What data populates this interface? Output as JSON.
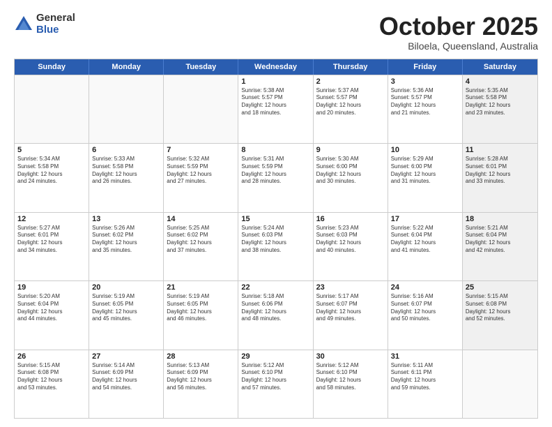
{
  "logo": {
    "general": "General",
    "blue": "Blue"
  },
  "title": "October 2025",
  "location": "Biloela, Queensland, Australia",
  "weekdays": [
    "Sunday",
    "Monday",
    "Tuesday",
    "Wednesday",
    "Thursday",
    "Friday",
    "Saturday"
  ],
  "rows": [
    [
      {
        "day": "",
        "text": ""
      },
      {
        "day": "",
        "text": ""
      },
      {
        "day": "",
        "text": ""
      },
      {
        "day": "1",
        "text": "Sunrise: 5:38 AM\nSunset: 5:57 PM\nDaylight: 12 hours\nand 18 minutes."
      },
      {
        "day": "2",
        "text": "Sunrise: 5:37 AM\nSunset: 5:57 PM\nDaylight: 12 hours\nand 20 minutes."
      },
      {
        "day": "3",
        "text": "Sunrise: 5:36 AM\nSunset: 5:57 PM\nDaylight: 12 hours\nand 21 minutes."
      },
      {
        "day": "4",
        "text": "Sunrise: 5:35 AM\nSunset: 5:58 PM\nDaylight: 12 hours\nand 23 minutes."
      }
    ],
    [
      {
        "day": "5",
        "text": "Sunrise: 5:34 AM\nSunset: 5:58 PM\nDaylight: 12 hours\nand 24 minutes."
      },
      {
        "day": "6",
        "text": "Sunrise: 5:33 AM\nSunset: 5:58 PM\nDaylight: 12 hours\nand 26 minutes."
      },
      {
        "day": "7",
        "text": "Sunrise: 5:32 AM\nSunset: 5:59 PM\nDaylight: 12 hours\nand 27 minutes."
      },
      {
        "day": "8",
        "text": "Sunrise: 5:31 AM\nSunset: 5:59 PM\nDaylight: 12 hours\nand 28 minutes."
      },
      {
        "day": "9",
        "text": "Sunrise: 5:30 AM\nSunset: 6:00 PM\nDaylight: 12 hours\nand 30 minutes."
      },
      {
        "day": "10",
        "text": "Sunrise: 5:29 AM\nSunset: 6:00 PM\nDaylight: 12 hours\nand 31 minutes."
      },
      {
        "day": "11",
        "text": "Sunrise: 5:28 AM\nSunset: 6:01 PM\nDaylight: 12 hours\nand 33 minutes."
      }
    ],
    [
      {
        "day": "12",
        "text": "Sunrise: 5:27 AM\nSunset: 6:01 PM\nDaylight: 12 hours\nand 34 minutes."
      },
      {
        "day": "13",
        "text": "Sunrise: 5:26 AM\nSunset: 6:02 PM\nDaylight: 12 hours\nand 35 minutes."
      },
      {
        "day": "14",
        "text": "Sunrise: 5:25 AM\nSunset: 6:02 PM\nDaylight: 12 hours\nand 37 minutes."
      },
      {
        "day": "15",
        "text": "Sunrise: 5:24 AM\nSunset: 6:03 PM\nDaylight: 12 hours\nand 38 minutes."
      },
      {
        "day": "16",
        "text": "Sunrise: 5:23 AM\nSunset: 6:03 PM\nDaylight: 12 hours\nand 40 minutes."
      },
      {
        "day": "17",
        "text": "Sunrise: 5:22 AM\nSunset: 6:04 PM\nDaylight: 12 hours\nand 41 minutes."
      },
      {
        "day": "18",
        "text": "Sunrise: 5:21 AM\nSunset: 6:04 PM\nDaylight: 12 hours\nand 42 minutes."
      }
    ],
    [
      {
        "day": "19",
        "text": "Sunrise: 5:20 AM\nSunset: 6:04 PM\nDaylight: 12 hours\nand 44 minutes."
      },
      {
        "day": "20",
        "text": "Sunrise: 5:19 AM\nSunset: 6:05 PM\nDaylight: 12 hours\nand 45 minutes."
      },
      {
        "day": "21",
        "text": "Sunrise: 5:19 AM\nSunset: 6:05 PM\nDaylight: 12 hours\nand 46 minutes."
      },
      {
        "day": "22",
        "text": "Sunrise: 5:18 AM\nSunset: 6:06 PM\nDaylight: 12 hours\nand 48 minutes."
      },
      {
        "day": "23",
        "text": "Sunrise: 5:17 AM\nSunset: 6:07 PM\nDaylight: 12 hours\nand 49 minutes."
      },
      {
        "day": "24",
        "text": "Sunrise: 5:16 AM\nSunset: 6:07 PM\nDaylight: 12 hours\nand 50 minutes."
      },
      {
        "day": "25",
        "text": "Sunrise: 5:15 AM\nSunset: 6:08 PM\nDaylight: 12 hours\nand 52 minutes."
      }
    ],
    [
      {
        "day": "26",
        "text": "Sunrise: 5:15 AM\nSunset: 6:08 PM\nDaylight: 12 hours\nand 53 minutes."
      },
      {
        "day": "27",
        "text": "Sunrise: 5:14 AM\nSunset: 6:09 PM\nDaylight: 12 hours\nand 54 minutes."
      },
      {
        "day": "28",
        "text": "Sunrise: 5:13 AM\nSunset: 6:09 PM\nDaylight: 12 hours\nand 56 minutes."
      },
      {
        "day": "29",
        "text": "Sunrise: 5:12 AM\nSunset: 6:10 PM\nDaylight: 12 hours\nand 57 minutes."
      },
      {
        "day": "30",
        "text": "Sunrise: 5:12 AM\nSunset: 6:10 PM\nDaylight: 12 hours\nand 58 minutes."
      },
      {
        "day": "31",
        "text": "Sunrise: 5:11 AM\nSunset: 6:11 PM\nDaylight: 12 hours\nand 59 minutes."
      },
      {
        "day": "",
        "text": ""
      }
    ]
  ]
}
